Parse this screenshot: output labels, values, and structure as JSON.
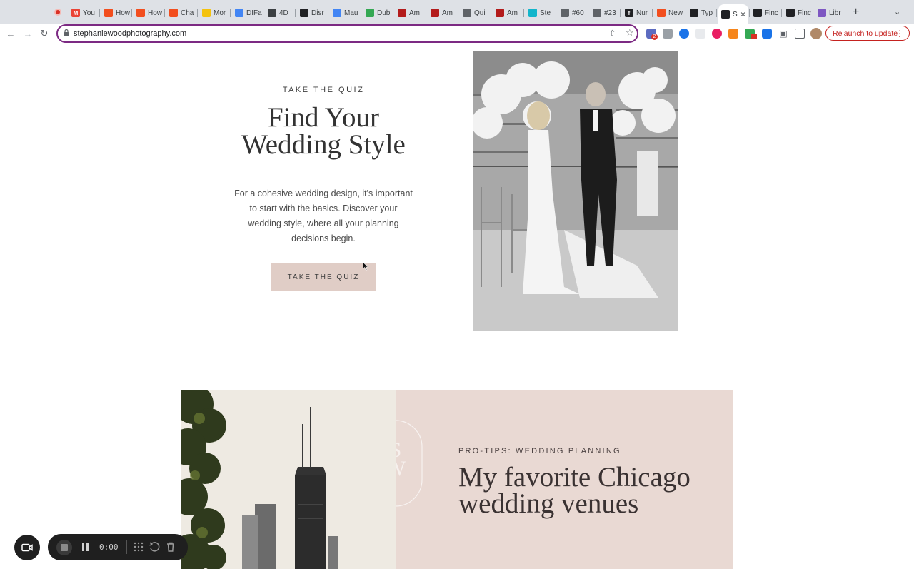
{
  "browser": {
    "tabs": [
      {
        "label": "You",
        "color": "#ea4335",
        "glyph": "M"
      },
      {
        "label": "How",
        "color": "#f24e1e",
        "glyph": ""
      },
      {
        "label": "How",
        "color": "#f24e1e",
        "glyph": ""
      },
      {
        "label": "Cha",
        "color": "#f24e1e",
        "glyph": ""
      },
      {
        "label": "Mor",
        "color": "#f4c20d",
        "glyph": ""
      },
      {
        "label": "DIFa",
        "color": "#4285f4",
        "glyph": ""
      },
      {
        "label": "4D",
        "color": "#3c4043",
        "glyph": ""
      },
      {
        "label": "Disr",
        "color": "#202124",
        "glyph": ""
      },
      {
        "label": "Mau",
        "color": "#4285f4",
        "glyph": ""
      },
      {
        "label": "Dub",
        "color": "#34a853",
        "glyph": ""
      },
      {
        "label": "Am",
        "color": "#b31b1b",
        "glyph": ""
      },
      {
        "label": "Am",
        "color": "#b31b1b",
        "glyph": ""
      },
      {
        "label": "Qui",
        "color": "#5f6368",
        "glyph": ""
      },
      {
        "label": "Am",
        "color": "#b31b1b",
        "glyph": ""
      },
      {
        "label": "Ste",
        "color": "#12b5cb",
        "glyph": ""
      },
      {
        "label": "#60",
        "color": "#5f6368",
        "glyph": ""
      },
      {
        "label": "#23",
        "color": "#5f6368",
        "glyph": ""
      },
      {
        "label": "Nur",
        "color": "#202124",
        "glyph": "f"
      },
      {
        "label": "New",
        "color": "#f24e1e",
        "glyph": ""
      },
      {
        "label": "Typ",
        "color": "#202124",
        "glyph": ""
      },
      {
        "label": "S",
        "color": "#202124",
        "glyph": "",
        "active": true
      },
      {
        "label": "Finc",
        "color": "#202124",
        "glyph": ""
      },
      {
        "label": "Finc",
        "color": "#202124",
        "glyph": ""
      },
      {
        "label": "Libr",
        "color": "#7e57c2",
        "glyph": ""
      }
    ],
    "url": "stephaniewoodphotography.com",
    "relaunch_label": "Relaunch to update",
    "extension_badge": "2"
  },
  "quiz": {
    "eyebrow": "TAKE THE QUIZ",
    "title_line1": "Find Your",
    "title_line2": "Wedding Style",
    "description": "For a cohesive wedding design, it's important to start with the basics. Discover your wedding style, where all your planning decisions begin.",
    "button_label": "TAKE THE QUIZ"
  },
  "venues": {
    "eyebrow": "PRO-TIPS: WEDDING PLANNING",
    "title_line1": "My favorite Chicago",
    "title_line2": "wedding venues",
    "monogram": "SW"
  },
  "recorder": {
    "time": "0:00"
  },
  "colors": {
    "accent_border": "#7c2a83",
    "button_bg": "#e0cdc6",
    "panel_bg": "#e9d9d3",
    "relaunch": "#c5221f"
  }
}
